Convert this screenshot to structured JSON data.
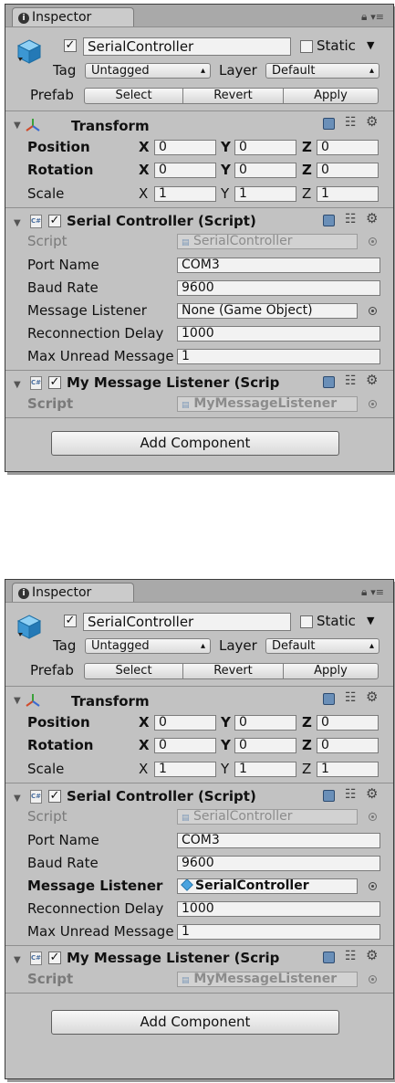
{
  "panels": [
    {
      "tab_label": "Inspector",
      "object_name": "SerialController",
      "static_label": "Static",
      "tag_label": "Tag",
      "tag_value": "Untagged",
      "layer_label": "Layer",
      "layer_value": "Default",
      "prefab_label": "Prefab",
      "prefab_select": "Select",
      "prefab_revert": "Revert",
      "prefab_apply": "Apply",
      "transform": {
        "title": "Transform",
        "rows": [
          {
            "label": "Position",
            "x": "0",
            "y": "0",
            "z": "0"
          },
          {
            "label": "Rotation",
            "x": "0",
            "y": "0",
            "z": "0"
          },
          {
            "label": "Scale",
            "x": "1",
            "y": "1",
            "z": "1"
          }
        ]
      },
      "serial": {
        "title": "Serial Controller (Script)",
        "script_label": "Script",
        "script_value": "SerialController",
        "port_label": "Port Name",
        "port_value": "COM3",
        "baud_label": "Baud Rate",
        "baud_value": "9600",
        "listener_label": "Message Listener",
        "listener_value": "None (Game Object)",
        "reconnect_label": "Reconnection Delay",
        "reconnect_value": "1000",
        "maxunread_label": "Max Unread Message",
        "maxunread_value": "1"
      },
      "listener_comp": {
        "title": "My Message Listener (Scrip",
        "script_label": "Script",
        "script_value": "MyMessageListener"
      },
      "add_component": "Add Component"
    },
    {
      "tab_label": "Inspector",
      "object_name": "SerialController",
      "static_label": "Static",
      "tag_label": "Tag",
      "tag_value": "Untagged",
      "layer_label": "Layer",
      "layer_value": "Default",
      "prefab_label": "Prefab",
      "prefab_select": "Select",
      "prefab_revert": "Revert",
      "prefab_apply": "Apply",
      "transform": {
        "title": "Transform",
        "rows": [
          {
            "label": "Position",
            "x": "0",
            "y": "0",
            "z": "0"
          },
          {
            "label": "Rotation",
            "x": "0",
            "y": "0",
            "z": "0"
          },
          {
            "label": "Scale",
            "x": "1",
            "y": "1",
            "z": "1"
          }
        ]
      },
      "serial": {
        "title": "Serial Controller (Script)",
        "script_label": "Script",
        "script_value": "SerialController",
        "port_label": "Port Name",
        "port_value": "COM3",
        "baud_label": "Baud Rate",
        "baud_value": "9600",
        "listener_label": "Message Listener",
        "listener_value": "SerialController",
        "reconnect_label": "Reconnection Delay",
        "reconnect_value": "1000",
        "maxunread_label": "Max Unread Message",
        "maxunread_value": "1"
      },
      "listener_comp": {
        "title": "My Message Listener (Scrip",
        "script_label": "Script",
        "script_value": "MyMessageListener"
      },
      "add_component": "Add Component"
    }
  ],
  "axis_labels": {
    "x": "X",
    "y": "Y",
    "z": "Z"
  },
  "icons": {
    "info": "info-icon",
    "lock": "lock-icon",
    "menu": "menu-icon",
    "cube": "gameobject-cube-icon",
    "transform": "transform-axes-icon",
    "script": "csharp-script-icon",
    "help": "help-book-icon",
    "presets": "presets-icon",
    "gear": "gear-icon",
    "target": "object-picker-icon"
  },
  "colors": {
    "panel_bg": "#c2c2c2",
    "tab_bar": "#a9a9a9",
    "field_bg": "#f2f2f2",
    "cube_blue": "#4aa3df"
  }
}
